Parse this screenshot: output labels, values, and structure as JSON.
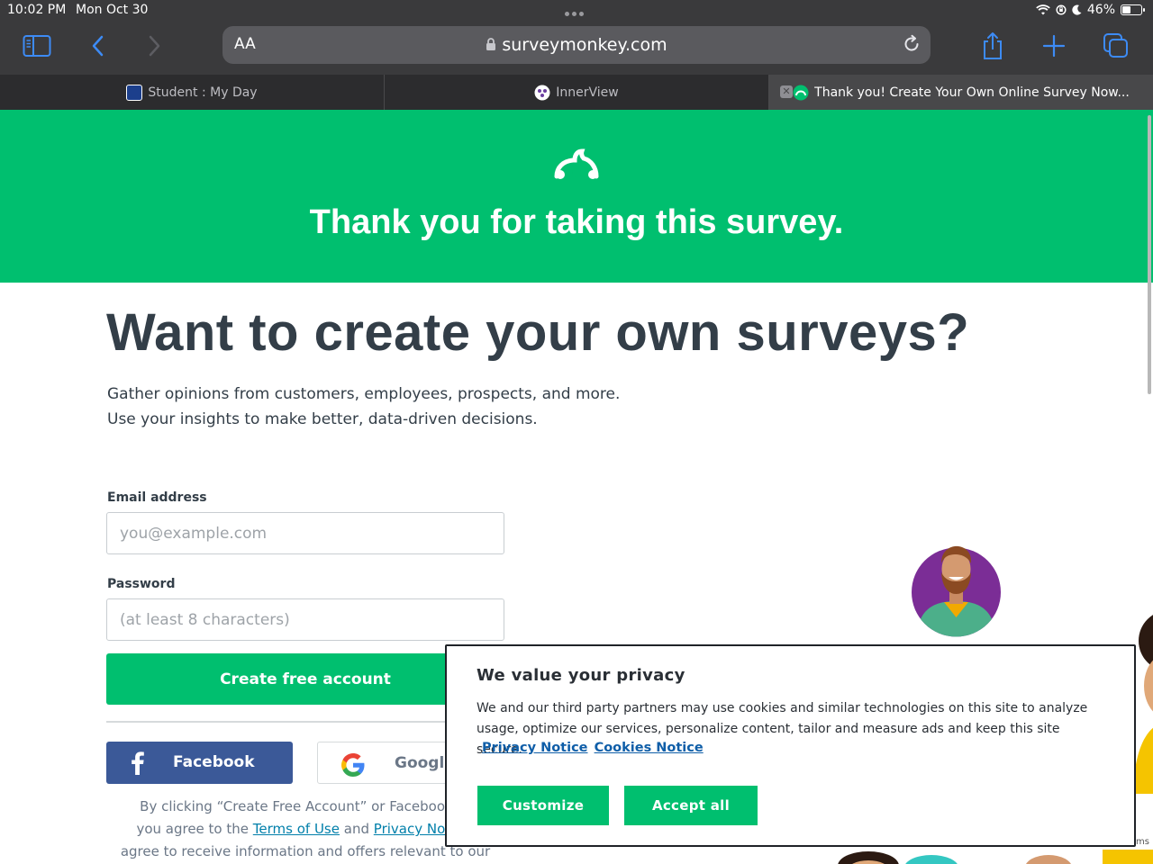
{
  "status_bar": {
    "time": "10:02 PM",
    "date": "Mon Oct 30",
    "battery": "46%",
    "battery_level": 0.46
  },
  "toolbar": {
    "text_size_label": "AA",
    "url_host": "surveymonkey.com"
  },
  "tabs": [
    {
      "label": "Student : My Day",
      "active": false
    },
    {
      "label": "InnerView",
      "active": false
    },
    {
      "label": "Thank you! Create Your Own Online Survey Now...",
      "active": true
    }
  ],
  "hero": {
    "title": "Thank you for taking this survey."
  },
  "signup": {
    "heading": "Want to create your own surveys?",
    "lead_line1": "Gather opinions from customers, employees, prospects, and more.",
    "lead_line2": "Use your insights to make better, data-driven decisions.",
    "email_label": "Email address",
    "email_placeholder": "you@example.com",
    "password_label": "Password",
    "password_placeholder": "(at least 8 characters)",
    "cta_label": "Create free account",
    "facebook_label": "Facebook",
    "google_label": "Google",
    "legal_part1": "By clicking “Create Free Account” or Facebook or",
    "legal_part2": "you agree to the",
    "terms_link": "Terms of Use",
    "legal_and": "and",
    "privacy_link": "Privacy Notice",
    "legal_part3": ".",
    "legal_part4": "agree to receive information and offers relevant to our"
  },
  "cookie": {
    "title": "We value your privacy",
    "body": "We and our third party partners may use cookies and similar technologies on this site to analyze usage, optimize our services, personalize content, tailor and measure ads and keep this site secure.",
    "privacy_link": "Privacy Notice",
    "cookies_link": "Cookies Notice",
    "customize_label": "Customize",
    "accept_label": "Accept all",
    "edge_fragment": "ms"
  },
  "colors": {
    "brand_green": "#00bf6f",
    "heading_text": "#333e48",
    "facebook_blue": "#3b5998",
    "link_blue": "#007faa",
    "chrome_dark": "#3a3a3c"
  }
}
